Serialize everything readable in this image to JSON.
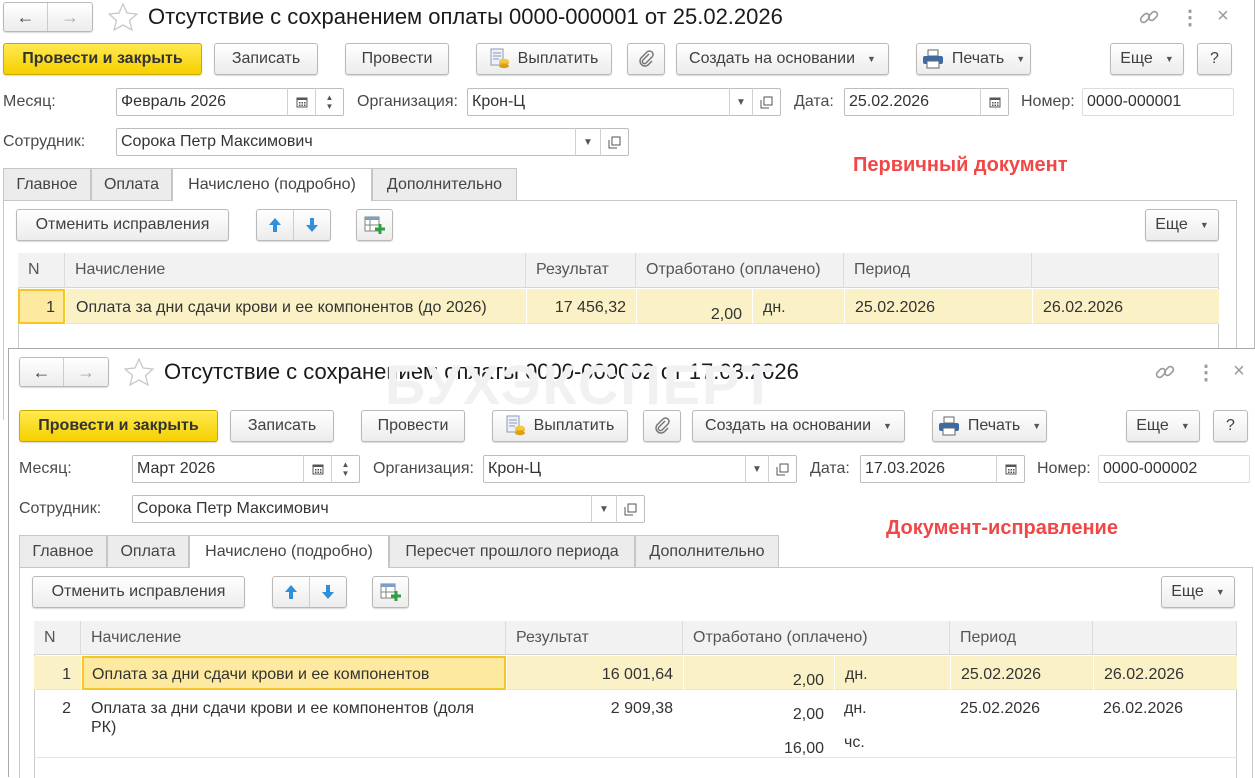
{
  "watermark": "БУХЭКСПЕРТ",
  "windows": [
    {
      "title": "Отсутствие с сохранением оплаты 0000-000001 от 25.02.2026",
      "annotation": "Первичный документ",
      "toolbar": {
        "post_close": "Провести и закрыть",
        "save": "Записать",
        "post": "Провести",
        "pay": "Выплатить",
        "create_based": "Создать на основании",
        "print": "Печать",
        "more": "Еще",
        "help": "?"
      },
      "fields": {
        "month_label": "Месяц:",
        "month": "Февраль 2026",
        "org_label": "Организация:",
        "org": "Крон-Ц",
        "date_label": "Дата:",
        "date": "25.02.2026",
        "number_label": "Номер:",
        "number": "0000-000001",
        "employee_label": "Сотрудник:",
        "employee": "Сорока Петр Максимович"
      },
      "tabs": [
        "Главное",
        "Оплата",
        "Начислено (подробно)",
        "Дополнительно"
      ],
      "active_tab": 2,
      "panel": {
        "cancel_corrections": "Отменить исправления",
        "more": "Еще"
      },
      "table": {
        "headers": [
          "N",
          "Начисление",
          "Результат",
          "Отработано (оплачено)",
          "Период",
          ""
        ],
        "rows": [
          {
            "n": "1",
            "accrual": "Оплата за дни сдачи крови и ее компонентов (до 2026)",
            "result": "17 456,32",
            "worked": [
              "2,00"
            ],
            "units": [
              "дн."
            ],
            "from": "25.02.2026",
            "to": "26.02.2026",
            "selected": true,
            "current_cell": "n"
          }
        ]
      }
    },
    {
      "title": "Отсутствие с сохранением оплаты 0000-000002 от 17.03.2026",
      "annotation": "Документ-исправление",
      "toolbar": {
        "post_close": "Провести и закрыть",
        "save": "Записать",
        "post": "Провести",
        "pay": "Выплатить",
        "create_based": "Создать на основании",
        "print": "Печать",
        "more": "Еще",
        "help": "?"
      },
      "fields": {
        "month_label": "Месяц:",
        "month": "Март 2026",
        "org_label": "Организация:",
        "org": "Крон-Ц",
        "date_label": "Дата:",
        "date": "17.03.2026",
        "number_label": "Номер:",
        "number": "0000-000002",
        "employee_label": "Сотрудник:",
        "employee": "Сорока Петр Максимович"
      },
      "tabs": [
        "Главное",
        "Оплата",
        "Начислено (подробно)",
        "Пересчет прошлого периода",
        "Дополнительно"
      ],
      "active_tab": 2,
      "panel": {
        "cancel_corrections": "Отменить исправления",
        "more": "Еще"
      },
      "table": {
        "headers": [
          "N",
          "Начисление",
          "Результат",
          "Отработано (оплачено)",
          "Период",
          ""
        ],
        "rows": [
          {
            "n": "1",
            "accrual": "Оплата за дни сдачи крови и ее компонентов",
            "result": "16 001,64",
            "worked": [
              "2,00"
            ],
            "units": [
              "дн."
            ],
            "from": "25.02.2026",
            "to": "26.02.2026",
            "selected": true,
            "current_cell": "accrual"
          },
          {
            "n": "2",
            "accrual": "Оплата за дни сдачи крови и ее компонентов (доля РК)",
            "result": "2 909,38",
            "worked": [
              "2,00",
              "16,00"
            ],
            "units": [
              "дн.",
              "чс."
            ],
            "from": "25.02.2026",
            "to": "26.02.2026",
            "selected": false,
            "current_cell": ""
          }
        ]
      }
    }
  ]
}
